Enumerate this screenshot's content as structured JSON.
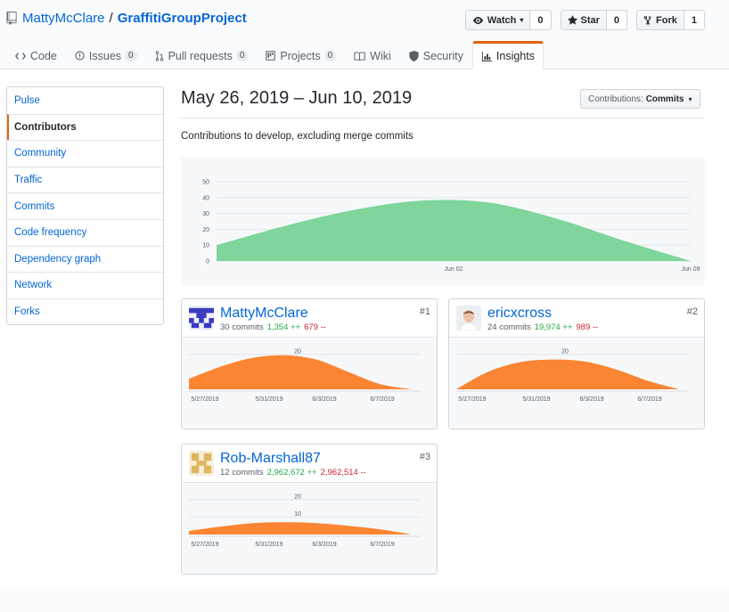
{
  "repo": {
    "owner": "MattyMcClare",
    "separator": "/",
    "name": "GraffitiGroupProject"
  },
  "actions": [
    {
      "label": "Watch",
      "count": "0",
      "icon": "eye-icon",
      "caret": "▾"
    },
    {
      "label": "Star",
      "count": "0",
      "icon": "star-icon"
    },
    {
      "label": "Fork",
      "count": "1",
      "icon": "fork-icon"
    }
  ],
  "tabs": [
    {
      "label": "Code",
      "icon": "code-icon"
    },
    {
      "label": "Issues",
      "badge": "0",
      "icon": "issue-icon"
    },
    {
      "label": "Pull requests",
      "badge": "0",
      "icon": "pull-request-icon"
    },
    {
      "label": "Projects",
      "badge": "0",
      "icon": "project-icon"
    },
    {
      "label": "Wiki",
      "icon": "book-icon"
    },
    {
      "label": "Security",
      "icon": "shield-icon"
    },
    {
      "label": "Insights",
      "icon": "graph-icon",
      "selected": true
    }
  ],
  "sidebar": {
    "items": [
      "Pulse",
      "Contributors",
      "Community",
      "Traffic",
      "Commits",
      "Code frequency",
      "Dependency graph",
      "Network",
      "Forks"
    ],
    "selected": "Contributors"
  },
  "range": "May 26, 2019 – Jun 10, 2019",
  "contrib_select": {
    "prefix": "Contributions:",
    "value": "Commits",
    "caret": "▾"
  },
  "description": "Contributions to develop, excluding merge commits",
  "colors": {
    "accent": "#e36209",
    "link": "#0366d6",
    "main_area": "#7fd59b",
    "contributor_area": "#fb8532",
    "additions": "#28a745",
    "deletions": "#cb2431"
  },
  "chart_data": [
    {
      "type": "area",
      "x": [
        "2019-05-26",
        "2019-05-28",
        "2019-05-30",
        "2019-06-01",
        "2019-06-03",
        "2019-06-05",
        "2019-06-07",
        "2019-06-09"
      ],
      "values": [
        10,
        22,
        32,
        38,
        37,
        27,
        13,
        0
      ],
      "yticks": [
        "0",
        "10",
        "20",
        "30",
        "40",
        "50"
      ],
      "xticks": [
        {
          "label": "Jun 02",
          "x": "2019-06-02"
        },
        {
          "label": "Jun 09",
          "x": "2019-06-09"
        }
      ],
      "ylim": [
        0,
        50
      ],
      "grid": true
    },
    {
      "type": "area",
      "title": "MattyMcClare",
      "x": [
        "2019-05-26",
        "2019-05-28",
        "2019-05-30",
        "2019-06-01",
        "2019-06-03",
        "2019-06-05",
        "2019-06-07",
        "2019-06-09"
      ],
      "values": [
        6,
        13,
        18,
        19.5,
        17,
        10,
        3,
        0
      ],
      "yticks": [
        "20"
      ],
      "ylim": [
        0,
        25
      ]
    },
    {
      "type": "area",
      "title": "ericxcross",
      "x": [
        "2019-05-26",
        "2019-05-28",
        "2019-05-30",
        "2019-06-01",
        "2019-06-03",
        "2019-06-05",
        "2019-06-07",
        "2019-06-09"
      ],
      "values": [
        0,
        10,
        15.5,
        17,
        16,
        11.5,
        5,
        0
      ],
      "yticks": [
        "20"
      ],
      "ylim": [
        0,
        25
      ]
    },
    {
      "type": "area",
      "title": "Rob-Marshall87",
      "x": [
        "2019-05-26",
        "2019-05-28",
        "2019-05-30",
        "2019-06-01",
        "2019-06-03",
        "2019-06-05",
        "2019-06-07",
        "2019-06-09"
      ],
      "values": [
        2,
        4.5,
        6.5,
        7,
        6.5,
        5,
        3,
        0
      ],
      "yticks": [
        "20",
        "10"
      ],
      "ylim": [
        0,
        25
      ]
    }
  ],
  "contributors": [
    {
      "login": "MattyMcClare",
      "commits": "30 commits",
      "additions": "1,354 ++",
      "deletions": "679 --",
      "rank": "#1",
      "avatar": "identicon-blue"
    },
    {
      "login": "ericxcross",
      "commits": "24 commits",
      "additions": "19,974 ++",
      "deletions": "989 --",
      "rank": "#2",
      "avatar": "photo"
    },
    {
      "login": "Rob-Marshall87",
      "commits": "12 commits",
      "additions": "2,962,672 ++",
      "deletions": "2,962,514 --",
      "rank": "#3",
      "avatar": "identicon-tan"
    }
  ],
  "contributor_xticks": [
    "5/27/2019",
    "5/31/2019",
    "6/3/2019",
    "6/7/2019"
  ]
}
